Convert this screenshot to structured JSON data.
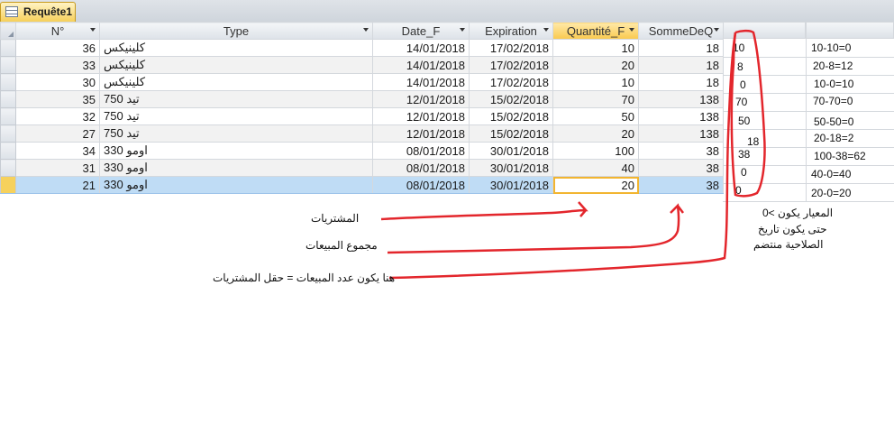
{
  "tab": {
    "title": "Requête1"
  },
  "columns": [
    "N°",
    "Type",
    "Date_F",
    "Expiration",
    "Quantité_F",
    "SommeDeQ"
  ],
  "rows": [
    {
      "n": "36",
      "type": "كلينيكس",
      "date": "14/01/2018",
      "exp": "17/02/2018",
      "qte": "10",
      "somme": "18"
    },
    {
      "n": "33",
      "type": "كلينيكس",
      "date": "14/01/2018",
      "exp": "17/02/2018",
      "qte": "20",
      "somme": "18"
    },
    {
      "n": "30",
      "type": "كلينيكس",
      "date": "14/01/2018",
      "exp": "17/02/2018",
      "qte": "10",
      "somme": "18"
    },
    {
      "n": "35",
      "type": "تيد 750",
      "date": "12/01/2018",
      "exp": "15/02/2018",
      "qte": "70",
      "somme": "138"
    },
    {
      "n": "32",
      "type": "تيد 750",
      "date": "12/01/2018",
      "exp": "15/02/2018",
      "qte": "50",
      "somme": "138"
    },
    {
      "n": "27",
      "type": "تيد 750",
      "date": "12/01/2018",
      "exp": "15/02/2018",
      "qte": "20",
      "somme": "138"
    },
    {
      "n": "34",
      "type": "اومو 330",
      "date": "08/01/2018",
      "exp": "30/01/2018",
      "qte": "100",
      "somme": "38"
    },
    {
      "n": "31",
      "type": "اومو 330",
      "date": "08/01/2018",
      "exp": "30/01/2018",
      "qte": "40",
      "somme": "38"
    },
    {
      "n": "21",
      "type": "اومو 330",
      "date": "08/01/2018",
      "exp": "30/01/2018",
      "qte": "20",
      "somme": "38"
    }
  ],
  "handwritten_values": [
    "10",
    "8",
    "0",
    "70",
    "50",
    "18",
    "38",
    "0",
    "0"
  ],
  "calculations": [
    "10-10=0",
    "20-8=12",
    "10-0=10",
    "70-70=0",
    "50-50=0",
    "20-18=2",
    "100-38=62",
    "40-0=40",
    "20-0=20"
  ],
  "annotations": {
    "purchases": "المشتريات",
    "sales_total": "مجموع المبيعات",
    "equality_note": "هنا يكون عدد المبيعات = حقل المشتريات",
    "criterion": [
      "0< المعيار يكون",
      "حتى يكون تاريخ",
      "الصلاحية منتضم"
    ]
  },
  "colors": {
    "pen": "#e3262c",
    "selected_row": "#bfdcf5",
    "active_header": "#f9c94e"
  }
}
